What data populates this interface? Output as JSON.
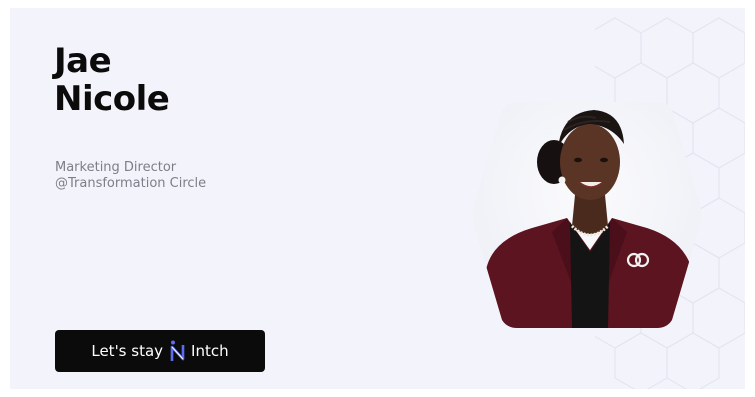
{
  "profile": {
    "first_name": "Jae",
    "last_name": "Nicole",
    "title_line1": "Marketing Director",
    "title_line2": "@Transformation Circle"
  },
  "cta": {
    "label_prefix": "Let's stay",
    "brand": "Intch",
    "logo_icon": "intch-logo-icon"
  },
  "colors": {
    "background": "#f3f4fb",
    "name": "#0b0b0b",
    "role": "#7c7f88",
    "button_bg": "#0b0b0b",
    "button_text": "#ffffff",
    "logo_accent": "#5b6cf0",
    "jacket": "#5c1420"
  }
}
